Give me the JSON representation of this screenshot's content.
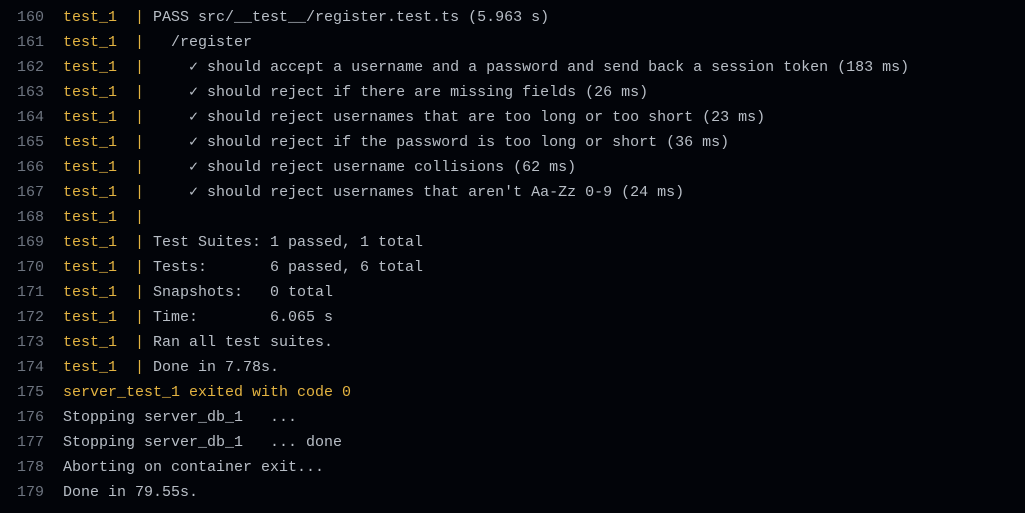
{
  "theme": {
    "background": "#020409",
    "line_number_color": "#6e7580",
    "service_color": "#e3b341",
    "text_color": "#b8bec6"
  },
  "lines": [
    {
      "n": "160",
      "svc": "test_1",
      "sep": "| ",
      "text": "PASS src/__test__/register.test.ts (5.963 s)"
    },
    {
      "n": "161",
      "svc": "test_1",
      "sep": "| ",
      "text": "  /register"
    },
    {
      "n": "162",
      "svc": "test_1",
      "sep": "| ",
      "text": "    ✓ should accept a username and a password and send back a session token (183 ms)"
    },
    {
      "n": "163",
      "svc": "test_1",
      "sep": "| ",
      "text": "    ✓ should reject if there are missing fields (26 ms)"
    },
    {
      "n": "164",
      "svc": "test_1",
      "sep": "| ",
      "text": "    ✓ should reject usernames that are too long or too short (23 ms)"
    },
    {
      "n": "165",
      "svc": "test_1",
      "sep": "| ",
      "text": "    ✓ should reject if the password is too long or short (36 ms)"
    },
    {
      "n": "166",
      "svc": "test_1",
      "sep": "| ",
      "text": "    ✓ should reject username collisions (62 ms)"
    },
    {
      "n": "167",
      "svc": "test_1",
      "sep": "| ",
      "text": "    ✓ should reject usernames that aren't Aa-Zz 0-9 (24 ms)"
    },
    {
      "n": "168",
      "svc": "test_1",
      "sep": "| ",
      "text": ""
    },
    {
      "n": "169",
      "svc": "test_1",
      "sep": "| ",
      "text": "Test Suites: 1 passed, 1 total"
    },
    {
      "n": "170",
      "svc": "test_1",
      "sep": "| ",
      "text": "Tests:       6 passed, 6 total"
    },
    {
      "n": "171",
      "svc": "test_1",
      "sep": "| ",
      "text": "Snapshots:   0 total"
    },
    {
      "n": "172",
      "svc": "test_1",
      "sep": "| ",
      "text": "Time:        6.065 s"
    },
    {
      "n": "173",
      "svc": "test_1",
      "sep": "| ",
      "text": "Ran all test suites."
    },
    {
      "n": "174",
      "svc": "test_1",
      "sep": "| ",
      "text": "Done in 7.78s."
    },
    {
      "n": "175",
      "svc": "",
      "sep": "",
      "text": "server_test_1 exited with code 0",
      "accent": true
    },
    {
      "n": "176",
      "svc": "",
      "sep": "",
      "text": "Stopping server_db_1   ..."
    },
    {
      "n": "177",
      "svc": "",
      "sep": "",
      "text": "Stopping server_db_1   ... done"
    },
    {
      "n": "178",
      "svc": "",
      "sep": "",
      "text": "Aborting on container exit..."
    },
    {
      "n": "179",
      "svc": "",
      "sep": "",
      "text": "Done in 79.55s."
    }
  ]
}
